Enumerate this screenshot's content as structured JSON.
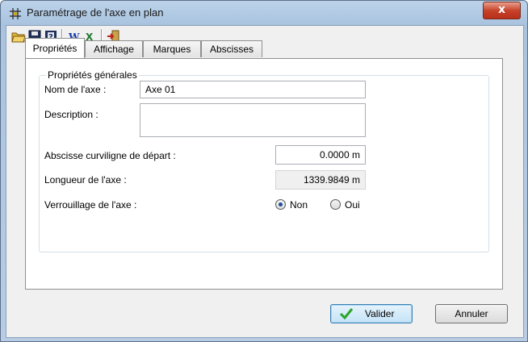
{
  "window": {
    "title": "Paramétrage de l'axe en plan",
    "close_symbol": "x"
  },
  "toolbar": {
    "icons": [
      "folder-open-icon",
      "save-icon",
      "help-icon",
      "word-icon",
      "excel-icon",
      "exit-icon"
    ]
  },
  "tabs": [
    {
      "label": "Propriétés",
      "active": true
    },
    {
      "label": "Affichage",
      "active": false
    },
    {
      "label": "Marques",
      "active": false
    },
    {
      "label": "Abscisses",
      "active": false
    }
  ],
  "group": {
    "title": "Propriétés générales",
    "name_label": "Nom de l'axe :",
    "name_value": "Axe 01",
    "description_label": "Description :",
    "description_value": "",
    "start_label": "Abscisse curviligne de départ :",
    "start_value": "0.0000 m",
    "length_label": "Longueur de l'axe :",
    "length_value": "1339.9849 m",
    "lock_label": "Verrouillage de l'axe :",
    "lock_options": [
      {
        "label": "Non",
        "checked": true
      },
      {
        "label": "Oui",
        "checked": false
      }
    ]
  },
  "buttons": {
    "ok_label": "Valider",
    "cancel_label": "Annuler"
  },
  "colors": {
    "titlebar": "#b8cde4",
    "close": "#c7432a",
    "check": "#2aa52a"
  }
}
